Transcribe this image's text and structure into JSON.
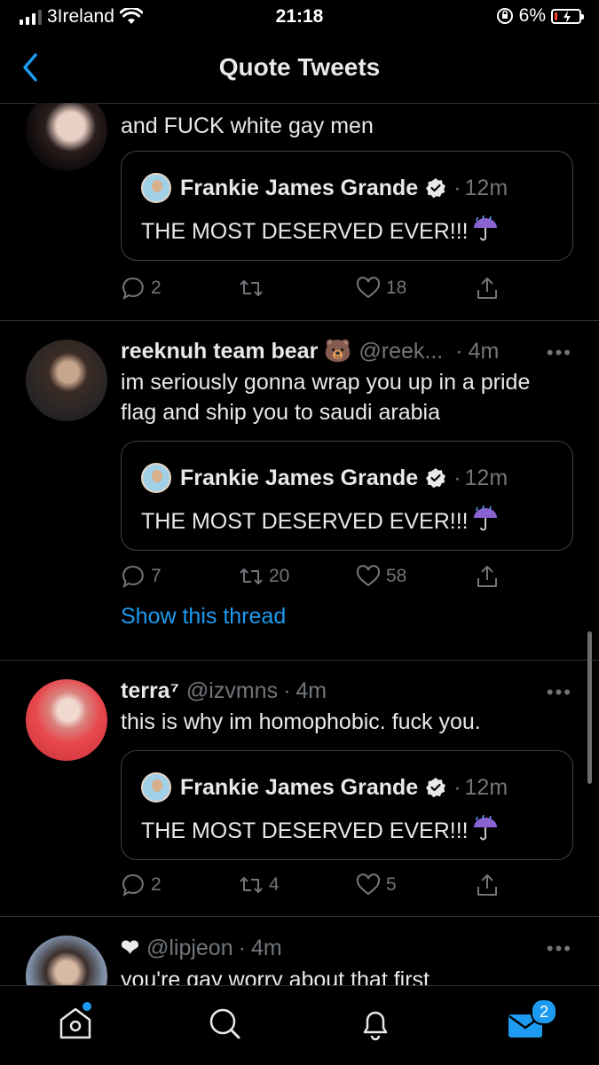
{
  "status_bar": {
    "carrier": "3Ireland",
    "time": "21:18",
    "battery": "6%"
  },
  "header": {
    "title": "Quote Tweets"
  },
  "quoted": {
    "name": "Frankie James Grande",
    "time": "12m",
    "text": "THE MOST DESERVED EVER!!!"
  },
  "tweets": [
    {
      "text": "and FUCK white gay men",
      "replies": "2",
      "retweets": "",
      "likes": "18"
    },
    {
      "name": "reeknuh team bear 🐻",
      "handle": "@reek...",
      "time": "4m",
      "text_line1": "im seriously gonna wrap you up in a pride",
      "text_line2": "flag and ship you to saudi arabia",
      "replies": "7",
      "retweets": "20",
      "likes": "58",
      "show_thread": "Show this thread"
    },
    {
      "name": "terra⁷",
      "handle": "@izvmns",
      "time": "4m",
      "text": "this is why im homophobic. fuck you.",
      "replies": "2",
      "retweets": "4",
      "likes": "5"
    },
    {
      "name": "❤",
      "handle": "@lipjeon",
      "time": "4m",
      "text": "you're gay worry about that first"
    }
  ],
  "tabbar": {
    "messages_badge": "2"
  },
  "colors": {
    "accent": "#1d9bf0",
    "background": "#000000",
    "muted": "#71767b"
  }
}
